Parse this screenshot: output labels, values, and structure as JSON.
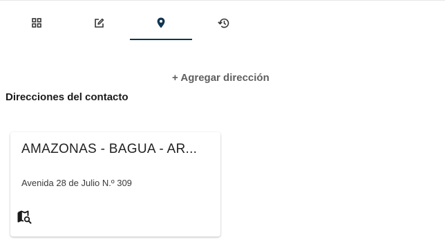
{
  "tabs": [
    {
      "icon": "grid-icon",
      "active": false
    },
    {
      "icon": "edit-icon",
      "active": false
    },
    {
      "icon": "location-pin-icon",
      "active": true
    },
    {
      "icon": "history-icon",
      "active": false
    }
  ],
  "add_address_label": "+ Agregar dirección",
  "section_title": "Direcciones del contacto",
  "addresses": [
    {
      "title": "AMAZONAS - BAGUA - AR...",
      "street": "Avenida 28 de Julio N.º 309",
      "action_icon": "map-search-icon"
    }
  ],
  "colors": {
    "active_tab_indicator": "#0f3550",
    "active_icon": "#0f3550",
    "icon": "#333333",
    "link_text": "#5f5f5f"
  }
}
